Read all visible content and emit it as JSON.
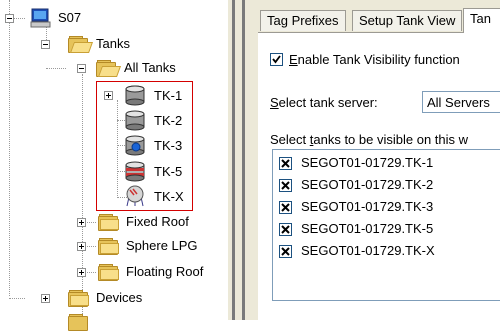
{
  "tree": {
    "root": {
      "label": "S07"
    },
    "tanks": {
      "label": "Tanks"
    },
    "all_tanks": {
      "label": "All Tanks"
    },
    "tank_items": [
      {
        "label": "TK-1",
        "icon": "tank-gray-icon"
      },
      {
        "label": "TK-2",
        "icon": "tank-gray-icon"
      },
      {
        "label": "TK-3",
        "icon": "tank-blue-icon"
      },
      {
        "label": "TK-5",
        "icon": "tank-striped-icon"
      },
      {
        "label": "TK-X",
        "icon": "sphere-tank-icon"
      }
    ],
    "groups": [
      {
        "label": "Fixed Roof"
      },
      {
        "label": "Sphere LPG"
      },
      {
        "label": "Floating Roof"
      }
    ],
    "devices": {
      "label": "Devices"
    }
  },
  "tabs": [
    {
      "label": "Tag Prefixes"
    },
    {
      "label": "Setup Tank View"
    },
    {
      "label": "Tan"
    }
  ],
  "panel": {
    "enable_visibility": {
      "label_underlined": "E",
      "label_rest": "nable Tank Visibility function",
      "checked": true
    },
    "server": {
      "label_underlined": "S",
      "label_rest": "elect tank server:",
      "value": "All Servers"
    },
    "tanks_prompt": {
      "prefix": "Select ",
      "underlined": "t",
      "suffix": "anks to be visible on this w"
    },
    "tank_list": [
      {
        "label": "SEGOT01-01729.TK-1",
        "checked": true
      },
      {
        "label": "SEGOT01-01729.TK-2",
        "checked": true
      },
      {
        "label": "SEGOT01-01729.TK-3",
        "checked": true
      },
      {
        "label": "SEGOT01-01729.TK-5",
        "checked": true
      },
      {
        "label": "SEGOT01-01729.TK-X",
        "checked": true
      }
    ]
  },
  "colors": {
    "selection_box": "#d40000",
    "folder": "#e6c35a",
    "panel_bg": "#ece9d8"
  }
}
